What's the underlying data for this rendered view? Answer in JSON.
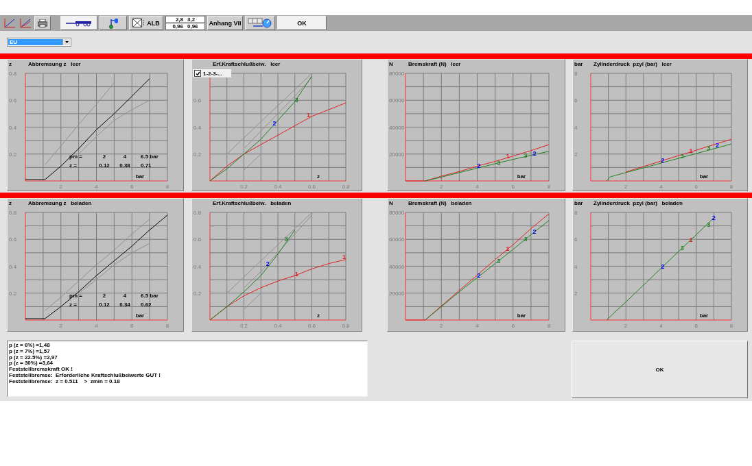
{
  "toolbar": [
    {
      "kind": "plain_icon"
    },
    {
      "kind": "plain_icon"
    },
    {
      "kind": "icon"
    },
    {
      "kind": "icon"
    },
    {
      "kind": "icon"
    },
    {
      "kind": "icon_label",
      "label": "ALB"
    },
    {
      "kind": "values",
      "rows": [
        [
          "2,8",
          "3,2"
        ],
        [
          "0,96",
          "0,96"
        ]
      ]
    },
    {
      "kind": "label",
      "label": "Anhang VII"
    },
    {
      "kind": "icon"
    },
    {
      "kind": "label",
      "label": "OK"
    }
  ],
  "region_select": {
    "value": "EU"
  },
  "chart_rows": [
    {
      "panels": [
        {
          "readout": [
            [
              "pm =",
              "2",
              "4",
              "6.5 bar"
            ],
            [
              "z =",
              "0.12",
              "0.38",
              "0.71"
            ]
          ],
          "chart_data": {
            "type": "line",
            "grid": true,
            "title": "Abbremsung z   leer",
            "ylabel": "z",
            "xlabel": "bar",
            "x": [
              0,
              1.1,
              2,
              3,
              4,
              5,
              6,
              7
            ],
            "xlim": [
              0,
              8
            ],
            "ylim": [
              0,
              0.8
            ],
            "xticks": [
              2,
              4,
              6,
              8
            ],
            "yticks": [
              0.2,
              0.4,
              0.6,
              0.8
            ],
            "series": [
              {
                "color": "#000000",
                "values": [
                  0.01,
                  0.01,
                  0.11,
                  0.24,
                  0.38,
                  0.5,
                  0.63,
                  0.76
                ]
              },
              {
                "color": "#909090",
                "values": [
                  null,
                  0.12,
                  0.26,
                  0.42,
                  0.57,
                  0.73,
                  null,
                  null
                ]
              },
              {
                "color": "#909090",
                "values": [
                  null,
                  null,
                  null,
                  0.2,
                  0.33,
                  0.45,
                  0.53,
                  0.6
                ]
              }
            ]
          }
        },
        {
          "legend_toggle": {
            "label": "1-2-3-...",
            "checked": true
          },
          "label_styles": [
            {
              "color": "#e02020"
            },
            {
              "color": "#0000ff"
            },
            {
              "color": "#208020"
            }
          ],
          "chart_data": {
            "type": "line",
            "grid": true,
            "title": "Erf.Kraftschlußbeiw.   leer",
            "xlabel": "z",
            "x": [
              0,
              0.1,
              0.2,
              0.3,
              0.4,
              0.5,
              0.6,
              0.7,
              0.8
            ],
            "xlim": [
              0,
              0.8
            ],
            "ylim": [
              0,
              0.8
            ],
            "xticks": [
              0.2,
              0.4,
              0.6,
              0.8
            ],
            "yticks": [
              0.2,
              0.4,
              0.6
            ],
            "series": [
              {
                "color": "#909090",
                "values": [
                  null,
                  0.2,
                  0.32,
                  0.44,
                  0.56,
                  0.68,
                  0.8,
                  null,
                  null
                ]
              },
              {
                "color": "#909090",
                "values": [
                  null,
                  null,
                  0.24,
                  0.37,
                  0.5,
                  0.63,
                  0.77,
                  null,
                  null
                ]
              },
              {
                "color": "#909090",
                "values": [
                  null,
                  null,
                  0.08,
                  0.2,
                  null,
                  null,
                  null,
                  null,
                  null
                ]
              },
              {
                "color": "#e02020",
                "values": [
                  0,
                  0.11,
                  0.2,
                  0.27,
                  0.34,
                  0.41,
                  0.48,
                  0.53,
                  0.58
                ]
              },
              {
                "color": "#208020",
                "values": [
                  0,
                  0.09,
                  0.2,
                  0.31,
                  0.45,
                  0.59,
                  0.78,
                  null,
                  null
                ]
              }
            ],
            "annotations": [
              {
                "text": "1",
                "x": 0.58,
                "y": 0.49
              },
              {
                "text": "2",
                "x": 0.38,
                "y": 0.43
              },
              {
                "text": "3",
                "x": 0.51,
                "y": 0.6
              }
            ]
          }
        },
        {
          "label_styles": [
            {
              "color": "#0000ff"
            },
            {
              "color": "#208020"
            },
            {
              "color": "#e02020"
            },
            {
              "color": "#208020"
            },
            {
              "color": "#0000ff"
            }
          ],
          "chart_data": {
            "type": "line",
            "grid": true,
            "title": "Bremskraft (N)   leer",
            "ylabel": "N",
            "xlabel": "bar",
            "x": [
              0,
              1.1,
              2,
              3,
              4,
              5,
              6,
              7,
              8
            ],
            "xlim": [
              0,
              8
            ],
            "ylim": [
              0,
              80000
            ],
            "xticks": [
              2,
              4,
              6,
              8
            ],
            "yticks": [
              20000,
              40000,
              60000,
              80000
            ],
            "series": [
              {
                "color": "#e02020",
                "values": [
                  0,
                  0,
                  3500,
                  7000,
                  11000,
                  14500,
                  18500,
                  22500,
                  27000
                ]
              },
              {
                "color": "#208020",
                "values": [
                  null,
                  0,
                  2800,
                  6200,
                  9500,
                  12800,
                  16000,
                  19000,
                  22000
                ]
              }
            ],
            "annotations": [
              {
                "text": "2",
                "x": 4.1,
                "y": 11000
              },
              {
                "text": "3",
                "x": 5.2,
                "y": 13500
              },
              {
                "text": "1",
                "x": 5.7,
                "y": 18500
              },
              {
                "text": "3",
                "x": 6.7,
                "y": 19000
              },
              {
                "text": "2",
                "x": 7.2,
                "y": 20500
              }
            ]
          }
        },
        {
          "label_styles": [
            {
              "color": "#0000ff"
            },
            {
              "color": "#208020"
            },
            {
              "color": "#e02020"
            },
            {
              "color": "#208020"
            },
            {
              "color": "#0000ff"
            }
          ],
          "chart_data": {
            "type": "line",
            "grid": true,
            "title": "Zylinderdruck  pzyl (bar)   leer",
            "ylabel": "bar",
            "xlabel": "bar",
            "x": [
              0.9,
              1.1,
              2,
              3,
              4,
              5,
              6,
              7,
              8
            ],
            "xlim": [
              0,
              8
            ],
            "ylim": [
              0,
              8
            ],
            "xticks": [
              2,
              4,
              6,
              8
            ],
            "yticks": [
              2,
              4,
              6,
              8
            ],
            "series": [
              {
                "color": "#e02020",
                "values": [
                  null,
                  null,
                  0.67,
                  1.07,
                  1.48,
                  1.88,
                  2.29,
                  2.7,
                  3.1
                ]
              },
              {
                "color": "#208020",
                "values": [
                  0,
                  0.3,
                  0.62,
                  0.97,
                  1.33,
                  1.68,
                  2.04,
                  2.39,
                  2.75
                ]
              }
            ],
            "annotations": [
              {
                "text": "2",
                "x": 4.1,
                "y": 1.55
              },
              {
                "text": "3",
                "x": 5.2,
                "y": 1.85
              },
              {
                "text": "1",
                "x": 5.7,
                "y": 2.25
              },
              {
                "text": "3",
                "x": 6.7,
                "y": 2.45
              },
              {
                "text": "2",
                "x": 7.2,
                "y": 2.65
              }
            ]
          }
        }
      ]
    },
    {
      "panels": [
        {
          "readout": [
            [
              "pm =",
              "2",
              "4",
              "6.5 bar"
            ],
            [
              "z =",
              "0.12",
              "0.34",
              "0.62"
            ]
          ],
          "chart_data": {
            "type": "line",
            "grid": true,
            "title": "Abbremsung z   beladen",
            "ylabel": "z",
            "xlabel": "bar",
            "x": [
              0,
              1.1,
              2,
              3,
              4,
              5,
              6,
              7,
              8
            ],
            "xlim": [
              0,
              8
            ],
            "ylim": [
              0,
              0.8
            ],
            "xticks": [
              2,
              4,
              6,
              8
            ],
            "yticks": [
              0.2,
              0.4,
              0.6,
              0.8
            ],
            "series": [
              {
                "color": "#000000",
                "values": [
                  0.01,
                  0.01,
                  0.1,
                  0.21,
                  0.33,
                  0.44,
                  0.55,
                  0.67,
                  0.78
                ]
              },
              {
                "color": "#909090",
                "values": [
                  null,
                  0.07,
                  0.17,
                  0.29,
                  0.41,
                  0.52,
                  0.64,
                  0.75,
                  null
                ]
              },
              {
                "color": "#909090",
                "values": [
                  null,
                  null,
                  null,
                  0.2,
                  0.3,
                  0.41,
                  0.5,
                  0.57,
                  null
                ]
              }
            ]
          }
        },
        {
          "label_styles": [
            {
              "color": "#e02020"
            },
            {
              "color": "#e02020"
            },
            {
              "color": "#0000ff"
            },
            {
              "color": "#208020"
            }
          ],
          "chart_data": {
            "type": "line",
            "grid": true,
            "title": "Erf.Kraftschlußbeiw.   beladen",
            "xlabel": "z",
            "x": [
              0,
              0.1,
              0.2,
              0.3,
              0.4,
              0.5,
              0.6,
              0.7,
              0.8
            ],
            "xlim": [
              0,
              0.8
            ],
            "ylim": [
              0,
              0.8
            ],
            "xticks": [
              0.2,
              0.4,
              0.6,
              0.8
            ],
            "yticks": [
              0.2,
              0.4,
              0.6,
              0.8
            ],
            "series": [
              {
                "color": "#909090",
                "values": [
                  null,
                  0.2,
                  0.32,
                  0.44,
                  0.56,
                  0.68,
                  0.8,
                  null,
                  null
                ]
              },
              {
                "color": "#909090",
                "values": [
                  null,
                  null,
                  0.24,
                  0.36,
                  0.5,
                  0.64,
                  0.78,
                  null,
                  null
                ]
              },
              {
                "color": "#909090",
                "values": [
                  null,
                  null,
                  0.08,
                  0.2,
                  null,
                  null,
                  null,
                  null,
                  null
                ]
              },
              {
                "color": "#e02020",
                "values": [
                  0,
                  0.1,
                  0.18,
                  0.24,
                  0.29,
                  0.33,
                  0.38,
                  0.42,
                  0.45
                ]
              },
              {
                "color": "#208020",
                "values": [
                  0,
                  0.1,
                  0.21,
                  0.33,
                  0.49,
                  0.67,
                  null,
                  null,
                  null
                ]
              }
            ],
            "annotations": [
              {
                "text": "1",
                "x": 0.79,
                "y": 0.47
              },
              {
                "text": "1",
                "x": 0.51,
                "y": 0.34
              },
              {
                "text": "2",
                "x": 0.34,
                "y": 0.42
              },
              {
                "text": "3",
                "x": 0.45,
                "y": 0.6
              }
            ]
          }
        },
        {
          "label_styles": [
            {
              "color": "#0000ff"
            },
            {
              "color": "#208020"
            },
            {
              "color": "#e02020"
            },
            {
              "color": "#208020"
            },
            {
              "color": "#0000ff"
            }
          ],
          "chart_data": {
            "type": "line",
            "grid": true,
            "title": "Bremskraft (N)   beladen",
            "ylabel": "N",
            "xlabel": "bar",
            "x": [
              0,
              1.1,
              2,
              3,
              4,
              5,
              6,
              7,
              8
            ],
            "xlim": [
              0,
              8
            ],
            "ylim": [
              0,
              80000
            ],
            "xticks": [
              2,
              4,
              6,
              8
            ],
            "yticks": [
              20000,
              40000,
              60000,
              80000
            ],
            "series": [
              {
                "color": "#e02020",
                "values": [
                  0,
                  0,
                  10500,
                  22000,
                  33500,
                  45000,
                  56000,
                  68000,
                  79000
                ]
              },
              {
                "color": "#208020",
                "values": [
                  null,
                  0,
                  10000,
                  21000,
                  31500,
                  42000,
                  52500,
                  63500,
                  74000
                ]
              }
            ],
            "annotations": [
              {
                "text": "2",
                "x": 4.1,
                "y": 33000
              },
              {
                "text": "3",
                "x": 5.2,
                "y": 44000
              },
              {
                "text": "1",
                "x": 5.7,
                "y": 53000
              },
              {
                "text": "3",
                "x": 6.7,
                "y": 60000
              },
              {
                "text": "2",
                "x": 7.2,
                "y": 65500
              }
            ]
          }
        },
        {
          "label_styles": [
            {
              "color": "#0000ff"
            },
            {
              "color": "#208020"
            },
            {
              "color": "#e02020"
            },
            {
              "color": "#208020"
            },
            {
              "color": "#0000ff"
            }
          ],
          "chart_data": {
            "type": "line",
            "grid": true,
            "title": "Zylinderdruck  pzyl (bar)   beladen",
            "ylabel": "bar",
            "xlabel": "bar",
            "x": [
              0.9,
              1.1,
              2,
              3,
              4,
              5,
              6,
              7
            ],
            "xlim": [
              0,
              8
            ],
            "ylim": [
              0,
              8
            ],
            "xticks": [
              2,
              4,
              6,
              8
            ],
            "yticks": [
              2,
              4,
              6,
              8
            ],
            "series": [
              {
                "color": "#208020",
                "values": [
                  0,
                  0.25,
                  1.35,
                  2.6,
                  3.85,
                  5.1,
                  6.35,
                  7.6
                ]
              }
            ],
            "annotations": [
              {
                "text": "2",
                "x": 4.1,
                "y": 3.98
              },
              {
                "text": "3",
                "x": 5.2,
                "y": 5.35
              },
              {
                "text": "1",
                "x": 5.7,
                "y": 5.98
              },
              {
                "text": "3",
                "x": 6.7,
                "y": 7.1
              },
              {
                "text": "2",
                "x": 7.0,
                "y": 7.6
              }
            ]
          }
        }
      ]
    }
  ],
  "messages": [
    "p (z = 6%) =1,48",
    "p (z = 7%) =1,57",
    "p (z = 22.5%) =2,97",
    "p (z = 30%) =3,64",
    "Feststellbremskraft OK !",
    "Feststellbremse:  Erforderliche Kraftschlußbeiwerte GUT !",
    "Feststellbremse:  z = 0.511    >  zmin = 0.18"
  ],
  "confirm_button": {
    "label": "OK"
  }
}
